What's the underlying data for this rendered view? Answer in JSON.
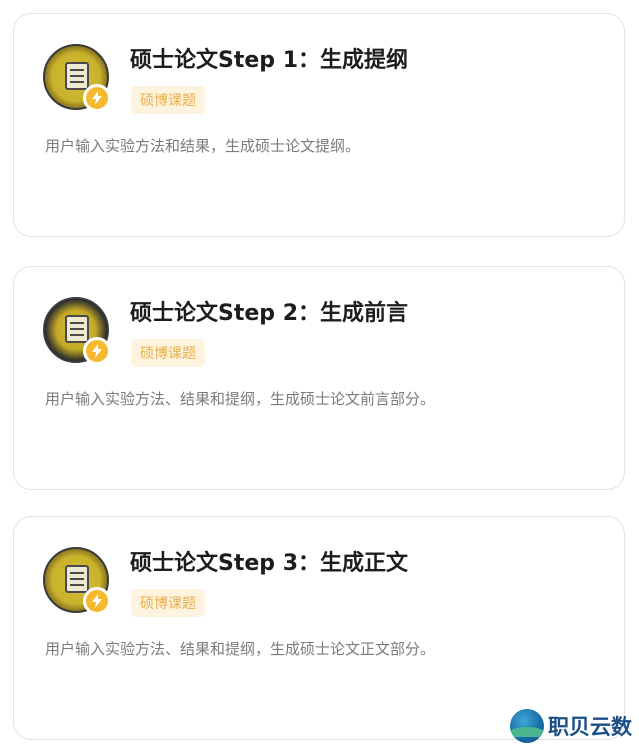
{
  "cards": [
    {
      "title": "硕士论文Step 1：生成提纲",
      "tag": "硕博课题",
      "description": "用户输入实验方法和结果，生成硕士论文提纲。",
      "avatar_icon": "thesis-avatar-icon"
    },
    {
      "title": "硕士论文Step 2：生成前言",
      "tag": "硕博课题",
      "description": "用户输入实验方法、结果和提纲，生成硕士论文前言部分。",
      "avatar_icon": "thesis-avatar-icon"
    },
    {
      "title": "硕士论文Step 3：生成正文",
      "tag": "硕博课题",
      "description": "用户输入实验方法、结果和提纲，生成硕士论文正文部分。",
      "avatar_icon": "thesis-avatar-icon"
    }
  ],
  "watermark": {
    "text": "职贝云数"
  },
  "colors": {
    "tag_bg": "#fdf3de",
    "tag_text": "#eab04a",
    "badge": "#f5b82e",
    "title": "#1d1d1f",
    "description": "#7b7b80"
  }
}
